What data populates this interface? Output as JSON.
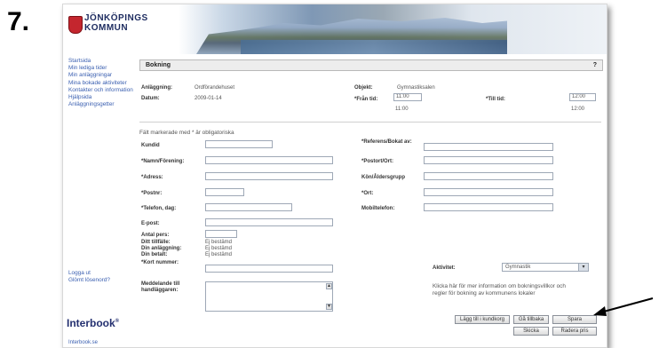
{
  "step_number": "7.",
  "brand": {
    "line1": "JÖNKÖPINGS",
    "line2": "KOMMUN",
    "footer_logo": "Interbook",
    "footer_link": "Interbook.se"
  },
  "sidebar": {
    "items": [
      "Startsida",
      "Min lediga tider",
      "Min anläggningar",
      "Mina bokade aktiviteter",
      "Kontakter och information",
      "Hjälpsida",
      "Anläggningsgetter"
    ],
    "logout": [
      "Logga ut",
      "Glömt lösenord?"
    ]
  },
  "form": {
    "title": "Bokning",
    "help": "?",
    "facility_label": "Anläggning:",
    "facility_value": "Ordförandehuset",
    "date_label": "Datum:",
    "date_value": "2009-01-14",
    "object_label": "Objekt:",
    "object_value": "Gymnastiksalen",
    "from_label": "*Från tid:",
    "from_value": "11:00",
    "from_sub": "11:00",
    "to_label": "*Till tid:",
    "to_value": "12:00",
    "to_sub": "12:00",
    "intro": "Fält markerade med * är obligatoriska",
    "left_labels": [
      "Kundid",
      "*Namn/Förening:",
      "*Adress:",
      "*Postnr:",
      "*Telefon, dag:",
      "E-post:"
    ],
    "right_labels": [
      "*Referens/Bokat av:",
      "*Postort/Ort:",
      "Kön/Åldersgrupp",
      "*Ort:",
      "Mobiltelefon:"
    ],
    "count_label": "Antal pers:",
    "radio_labels": [
      "Ditt tillfälle:",
      "Din anläggning:",
      "Din betalt:"
    ],
    "radio_values": [
      "Ej bestämd",
      "Ej bestämd",
      "Ej bestämd"
    ],
    "kort_label": "*Kort nummer:",
    "comment_label": "Meddelande till handläggaren:",
    "activity_label": "Aktivitet:",
    "activity_value": "Gymnastik",
    "info_text": "Klicka här för mer information om bokningsvillkor och regler för bokning av kommunens lokaler",
    "buttons": {
      "add_to_cart": "Lägg till i kundkorg",
      "go_back": "Gå tillbaka",
      "save": "Spara",
      "submit": "Skicka",
      "cancel": "Radera pris"
    }
  },
  "colors": {
    "link": "#3a5fb0",
    "logo_red": "#c4262e",
    "logo_navy": "#1d2b5f",
    "title_bg": "#ededed"
  }
}
